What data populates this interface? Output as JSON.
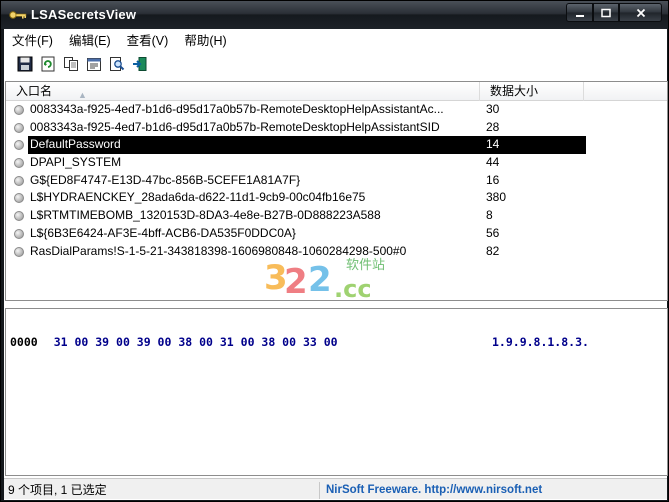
{
  "window": {
    "title": "LSASecretsView"
  },
  "menu": {
    "items": [
      {
        "label": "文件(F)"
      },
      {
        "label": "编辑(E)"
      },
      {
        "label": "查看(V)"
      },
      {
        "label": "帮助(H)"
      }
    ]
  },
  "toolbar": {
    "buttons": [
      {
        "icon": "save-icon"
      },
      {
        "icon": "refresh-icon"
      },
      {
        "icon": "copy-icon"
      },
      {
        "icon": "properties-icon"
      },
      {
        "icon": "find-icon"
      },
      {
        "icon": "exit-icon"
      }
    ]
  },
  "list": {
    "columns": {
      "name": "入口名",
      "size": "数据大小"
    },
    "rows": [
      {
        "name": "0083343a-f925-4ed7-b1d6-d95d17a0b57b-RemoteDesktopHelpAssistantAc...",
        "size": "30"
      },
      {
        "name": "0083343a-f925-4ed7-b1d6-d95d17a0b57b-RemoteDesktopHelpAssistantSID",
        "size": "28"
      },
      {
        "name": "DefaultPassword",
        "size": "14"
      },
      {
        "name": "DPAPI_SYSTEM",
        "size": "44"
      },
      {
        "name": "G${ED8F4747-E13D-47bc-856B-5CEFE1A81A7F}",
        "size": "16"
      },
      {
        "name": "L$HYDRAENCKEY_28ada6da-d622-11d1-9cb9-00c04fb16e75",
        "size": "380"
      },
      {
        "name": "L$RTMTIMEBOMB_1320153D-8DA3-4e8e-B27B-0D888223A588",
        "size": "8"
      },
      {
        "name": "L${6B3E6424-AF3E-4bff-ACB6-DA535F0DDC0A}",
        "size": "56"
      },
      {
        "name": "RasDialParams!S-1-5-21-343818398-1606980848-1060284298-500#0",
        "size": "82"
      }
    ],
    "selected_index": 2
  },
  "hex": {
    "offset": "0000",
    "bytes": "31 00 39 00 39 00 38 00 31 00 38 00 33 00",
    "ascii": "1.9.9.8.1.8.3."
  },
  "status": {
    "left": "9 个项目, 1 已选定",
    "right": "NirSoft Freeware.  http://www.nirsoft.net"
  },
  "watermark": {
    "text": "软件站"
  },
  "colors": {
    "selection": "#000000",
    "hex_text": "#00008b",
    "status_link": "#1a5fb4"
  }
}
